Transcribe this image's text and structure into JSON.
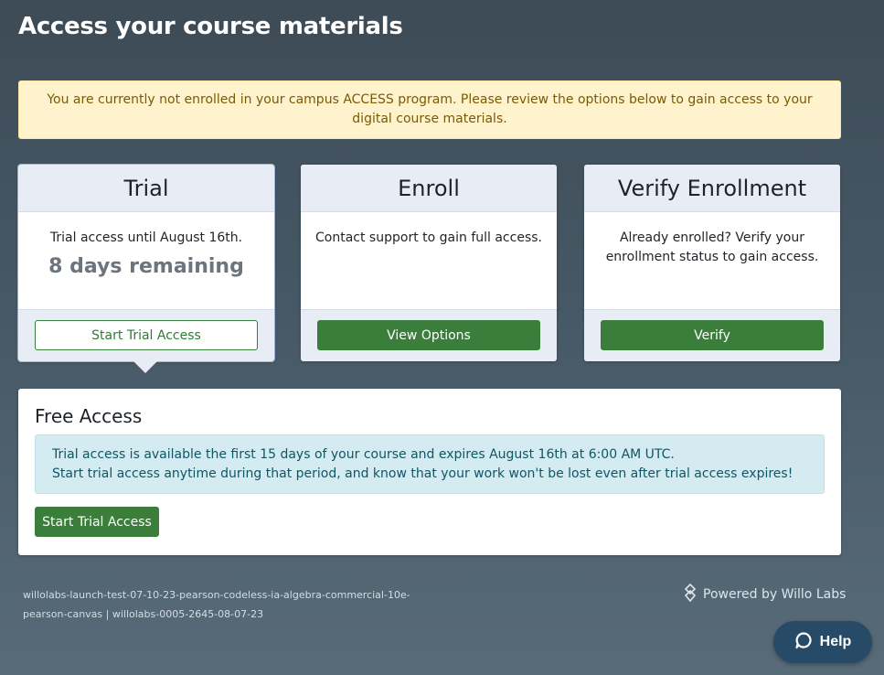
{
  "page": {
    "title": "Access your course materials"
  },
  "alert": {
    "text": "You are currently not enrolled in your campus ACCESS program. Please review the options below to gain access to your digital course materials."
  },
  "cards": [
    {
      "title": "Trial",
      "description": "Trial access until August 16th.",
      "remaining": "8 days remaining",
      "button_label": "Start Trial Access",
      "selected": true
    },
    {
      "title": "Enroll",
      "description": "Contact support to gain full access.",
      "button_label": "View Options"
    },
    {
      "title": "Verify Enrollment",
      "description": "Already enrolled? Verify your enrollment status to gain access.",
      "button_label": "Verify"
    }
  ],
  "free_access": {
    "title": "Free Access",
    "info_line1": "Trial access is available the first 15 days of your course and expires August 16th at 6:00 AM UTC.",
    "info_line2": "Start trial access anytime during that period, and know that your work won't be lost even after trial access expires!",
    "button_label": "Start Trial Access"
  },
  "footer": {
    "launch_id": "willolabs-launch-test-07-10-23-pearson-codeless-ia-algebra-commercial-10e-pearson-canvas | willolabs-0005-2645-08-07-23",
    "powered_by": "Powered by Willo Labs"
  },
  "help": {
    "label": "Help",
    "icon": "chat-bubble-icon"
  },
  "colors": {
    "accent_green": "#3b7d3b",
    "alert_bg": "#fff3cd",
    "info_bg": "#d4ebf1",
    "help_bg": "#274b66"
  }
}
